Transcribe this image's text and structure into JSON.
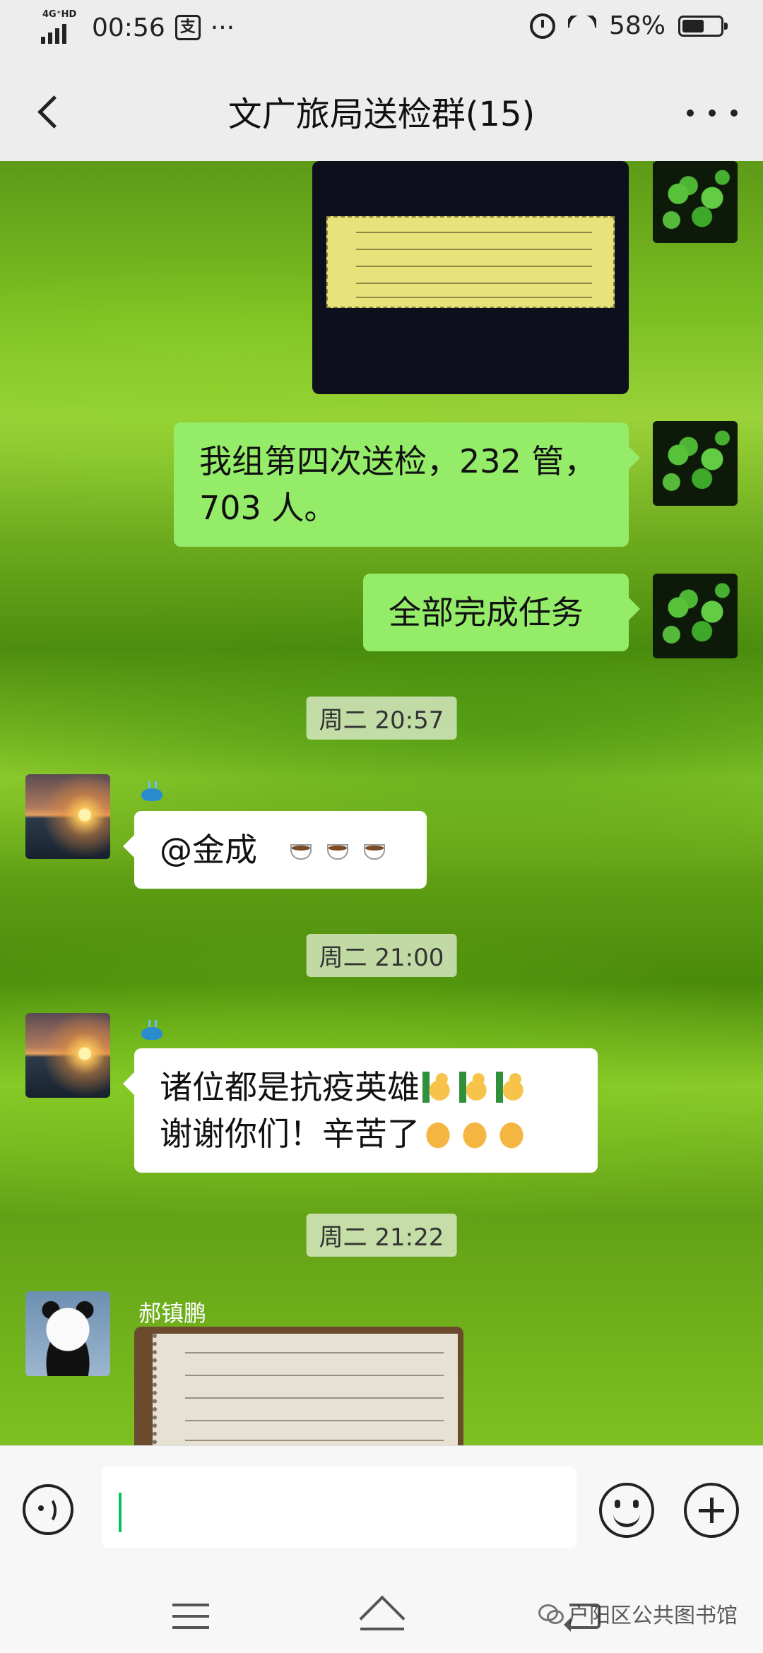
{
  "status_bar": {
    "network": "4G⁺HD",
    "time": "00:56",
    "pay_glyph": "支",
    "dots": "···",
    "battery": "58%",
    "battery_level": 0.58
  },
  "header": {
    "title": "文广旅局送检群(15)"
  },
  "messages": {
    "m2_text": "我组第四次送检，232 管，703 人。",
    "m3_text": "全部完成任务",
    "ts1": "周二 20:57",
    "m4_nick": "",
    "m4_text": "@金成",
    "ts2": "周二 21:00",
    "m5_line1": "诸位都是抗疫英雄",
    "m5_line2": "谢谢你们！辛苦了",
    "ts3": "周二 21:22",
    "m6_nick": "郝镇鹏"
  },
  "input": {
    "value": ""
  },
  "watermark": {
    "text": "户阳区公共图书馆"
  }
}
